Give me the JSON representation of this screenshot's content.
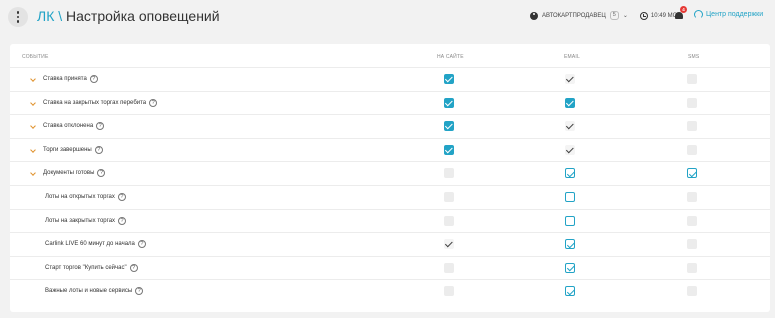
{
  "header": {
    "crumb": "ЛК",
    "separator": "\\",
    "page_title": "Настройка оповещений",
    "user_name": "АВТОКАРТПРОДАВЕЦ",
    "user_count": "5",
    "time": "10:49 МСК",
    "notifications_count": "4",
    "support_label": "Центр поддержки"
  },
  "table": {
    "columns": {
      "event": "СОБЫТИЕ",
      "site": "НА САЙТЕ",
      "email": "EMAIL",
      "sms": "SMS"
    },
    "rows": [
      {
        "label": "Ставка принята",
        "expandable": true,
        "site": "checked",
        "email": "check-only",
        "sms": "disabled"
      },
      {
        "label": "Ставка на закрытых торгах перебита",
        "expandable": true,
        "site": "checked",
        "email": "checked",
        "sms": "disabled"
      },
      {
        "label": "Ставка отклонена",
        "expandable": true,
        "site": "checked",
        "email": "check-only",
        "sms": "disabled"
      },
      {
        "label": "Торги завершены",
        "expandable": true,
        "site": "checked",
        "email": "check-only",
        "sms": "disabled"
      },
      {
        "label": "Документы готовы",
        "expandable": true,
        "site": "disabled",
        "email": "outlined-checked",
        "sms": "outlined-checked"
      },
      {
        "label": "Лоты на открытых торгах",
        "expandable": false,
        "site": "disabled",
        "email": "outlined",
        "sms": "disabled"
      },
      {
        "label": "Лоты на закрытых торгах",
        "expandable": false,
        "site": "disabled",
        "email": "outlined",
        "sms": "disabled"
      },
      {
        "label": "Carlink LIVE 60 минут до начала",
        "expandable": false,
        "site": "check-only",
        "email": "outlined-checked",
        "sms": "disabled"
      },
      {
        "label": "Старт торгов \"Купить сейчас\"",
        "expandable": false,
        "site": "disabled",
        "email": "outlined-checked",
        "sms": "disabled"
      },
      {
        "label": "Важные лоты и новые сервисы",
        "expandable": false,
        "site": "disabled",
        "email": "outlined-checked",
        "sms": "disabled"
      }
    ]
  },
  "colors": {
    "accent": "#22a3c6",
    "chevron": "#e0922e",
    "badge": "#e53935"
  }
}
